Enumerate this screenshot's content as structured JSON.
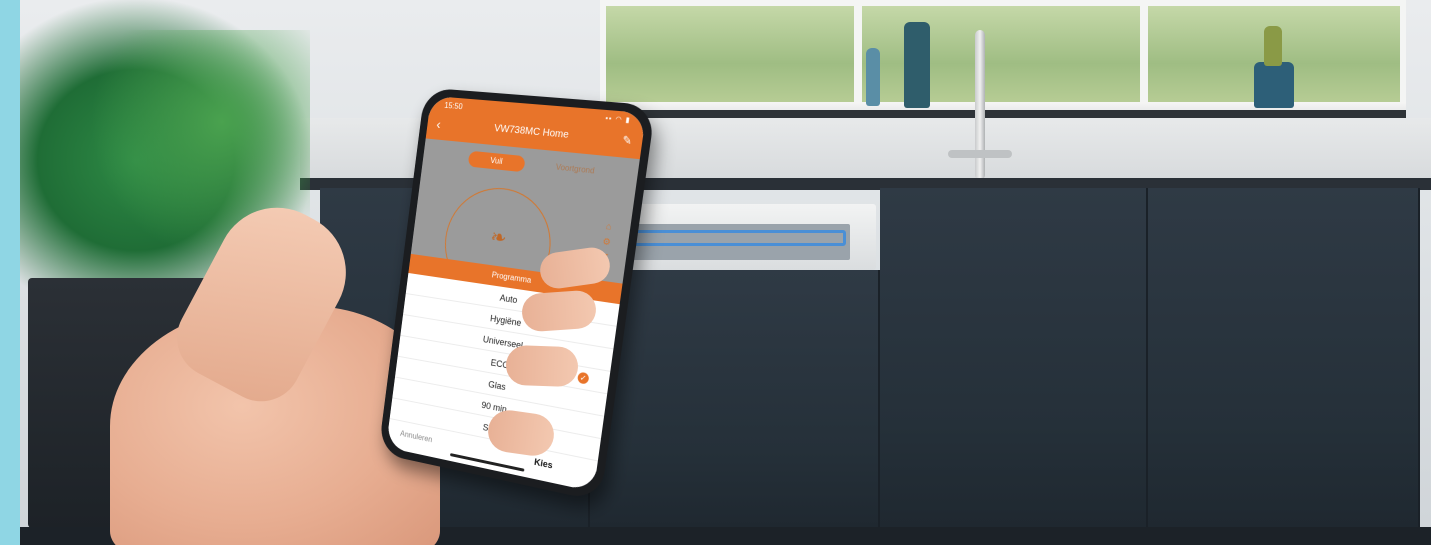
{
  "phone": {
    "status_time": "15:50",
    "status_icons": "▪▪ ◠ ▮",
    "app_title": "VW738MC Home",
    "back_icon": "‹",
    "edit_icon": "✎",
    "tab_active": "Vuil",
    "tab_inactive": "Voortgrond",
    "leaf_icon": "❧",
    "side_icons": [
      "⌂",
      "⚙",
      "↺",
      "▭"
    ],
    "sheet": {
      "title": "Programma",
      "options": [
        "Auto",
        "Hygiëne",
        "Universeel",
        "ECO",
        "Glas",
        "90 min",
        "Snel"
      ],
      "selected": "ECO",
      "check_icon": "✓",
      "cancel_label": "Annuleren",
      "choose_label": "Kies"
    }
  },
  "colors": {
    "accent": "#e8742a",
    "cabinet": "#2b3642"
  }
}
